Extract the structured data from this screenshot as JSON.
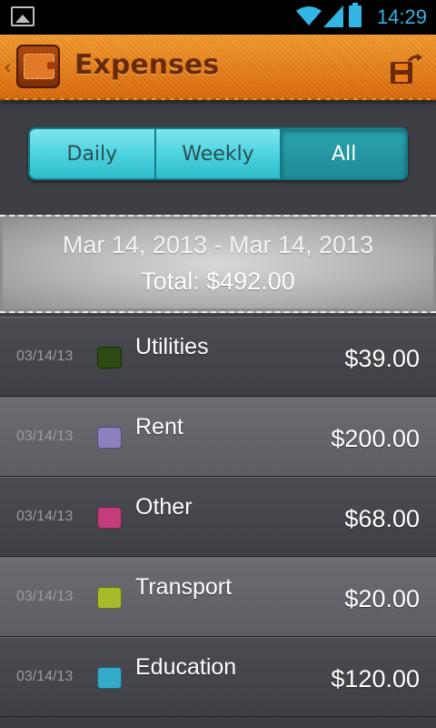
{
  "status_bar": {
    "time": "14:29",
    "icons": [
      "gallery-icon",
      "wifi-icon",
      "signal-icon",
      "battery-icon"
    ],
    "accent_color": "#33b5e5"
  },
  "header": {
    "title": "Expenses",
    "app_icon": "wallet-icon",
    "action_icon": "save-export-icon",
    "color": "#e67d17"
  },
  "tabs": [
    {
      "label": "Daily",
      "active": false
    },
    {
      "label": "Weekly",
      "active": false
    },
    {
      "label": "All",
      "active": true
    }
  ],
  "summary": {
    "range": "Mar 14, 2013 - Mar 14, 2013",
    "total": "Total: $492.00"
  },
  "expenses": [
    {
      "date": "03/14/13",
      "category": "Utilities",
      "amount": "$39.00",
      "color": "#2d4a12"
    },
    {
      "date": "03/14/13",
      "category": "Rent",
      "amount": "$200.00",
      "color": "#8d7fc0"
    },
    {
      "date": "03/14/13",
      "category": "Other",
      "amount": "$68.00",
      "color": "#c23e7a"
    },
    {
      "date": "03/14/13",
      "category": "Transport",
      "amount": "$20.00",
      "color": "#a8bb2a"
    },
    {
      "date": "03/14/13",
      "category": "Education",
      "amount": "$120.00",
      "color": "#35a9c8"
    }
  ]
}
